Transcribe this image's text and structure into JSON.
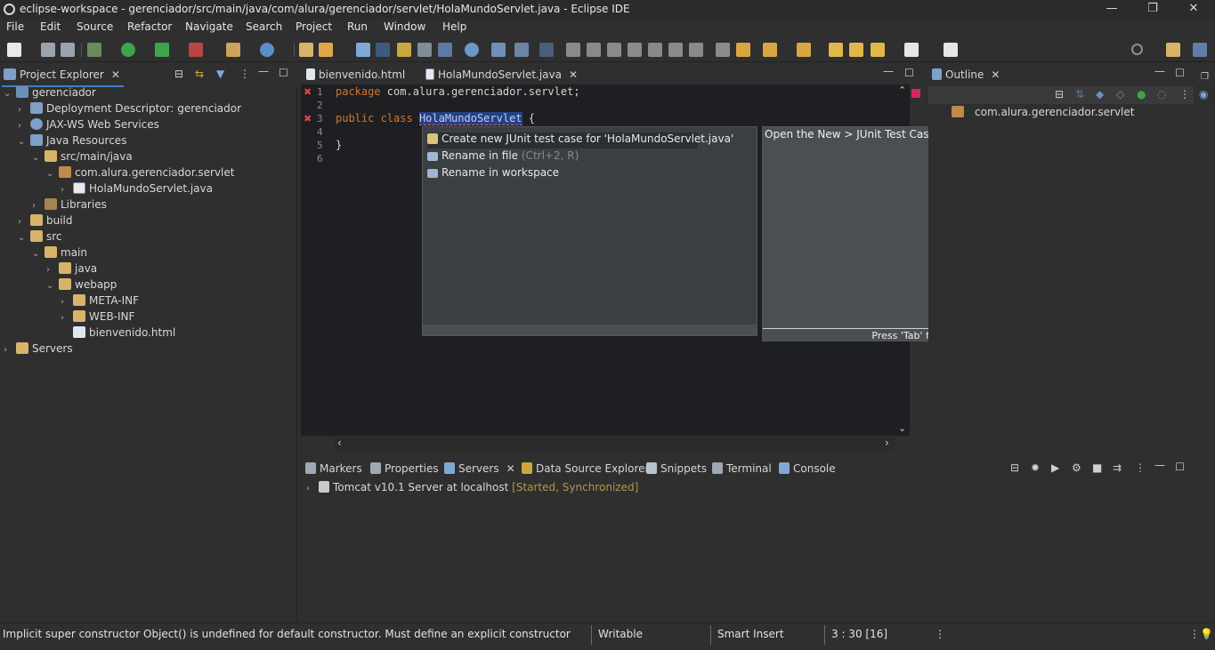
{
  "window": {
    "title": "eclipse-workspace - gerenciador/src/main/java/com/alura/gerenciador/servlet/HolaMundoServlet.java - Eclipse IDE",
    "minimize": "—",
    "maximize": "❐",
    "close": "✕"
  },
  "menu": [
    "File",
    "Edit",
    "Source",
    "Refactor",
    "Navigate",
    "Search",
    "Project",
    "Run",
    "Window",
    "Help"
  ],
  "project_explorer": {
    "tab_label": "Project Explorer",
    "items": [
      {
        "label": "gerenciador",
        "twisty": "⌄",
        "icon": "project-icon"
      },
      {
        "label": "Deployment Descriptor: gerenciador",
        "twisty": "›",
        "icon": "deployment-descriptor-icon"
      },
      {
        "label": "JAX-WS Web Services",
        "twisty": "›",
        "icon": "web-services-icon"
      },
      {
        "label": "Java Resources",
        "twisty": "⌄",
        "icon": "java-resources-icon"
      },
      {
        "label": "src/main/java",
        "twisty": "⌄",
        "icon": "source-folder-icon"
      },
      {
        "label": "com.alura.gerenciador.servlet",
        "twisty": "⌄",
        "icon": "package-icon"
      },
      {
        "label": "HolaMundoServlet.java",
        "twisty": "›",
        "icon": "java-file-icon"
      },
      {
        "label": "Libraries",
        "twisty": "›",
        "icon": "libraries-icon"
      },
      {
        "label": "build",
        "twisty": "›",
        "icon": "folder-icon"
      },
      {
        "label": "src",
        "twisty": "⌄",
        "icon": "folder-icon"
      },
      {
        "label": "main",
        "twisty": "⌄",
        "icon": "folder-icon"
      },
      {
        "label": "java",
        "twisty": "›",
        "icon": "folder-icon"
      },
      {
        "label": "webapp",
        "twisty": "⌄",
        "icon": "folder-icon"
      },
      {
        "label": "META-INF",
        "twisty": "›",
        "icon": "folder-icon"
      },
      {
        "label": "WEB-INF",
        "twisty": "›",
        "icon": "folder-icon"
      },
      {
        "label": "bienvenido.html",
        "twisty": "",
        "icon": "html-file-icon"
      },
      {
        "label": "Servers",
        "twisty": "›",
        "icon": "servers-folder-icon"
      }
    ]
  },
  "editor": {
    "tabs": [
      {
        "label": "bienvenido.html"
      },
      {
        "label": "HolaMundoServlet.java"
      }
    ],
    "line_numbers": [
      "1",
      "2",
      "3",
      "4",
      "5",
      "6"
    ],
    "line1_kw": "package",
    "line1_rest": " com.alura.gerenciador.servlet;",
    "line3_kw": "public class",
    "line3_class": "HolaMundoServlet",
    "line3_brace": " {",
    "line5": "}"
  },
  "quick_fix": {
    "proposals": [
      {
        "label": "Create new JUnit test case for 'HolaMundoServlet.java'",
        "hint": ""
      },
      {
        "label": "Rename in file",
        "hint": " (Ctrl+2, R)"
      },
      {
        "label": "Rename in workspace",
        "hint": ""
      }
    ],
    "info_text": "Open the New > JUnit Test Case wizard.",
    "footer": "Press 'Tab' from proposal table or click for focus"
  },
  "outline": {
    "tab_label": "Outline",
    "items": [
      "com.alura.gerenciador.servlet"
    ]
  },
  "bottom_panel": {
    "tabs": [
      "Markers",
      "Properties",
      "Servers",
      "Data Source Explorer",
      "Snippets",
      "Terminal",
      "Console"
    ],
    "server_name": "Tomcat v10.1 Server at localhost",
    "server_state": "[Started, Synchronized]"
  },
  "status_bar": {
    "message": "Implicit super constructor Object() is undefined for default constructor. Must define an explicit constructor",
    "writable": "Writable",
    "insert_mode": "Smart Insert",
    "position": "3 : 30 [16]"
  }
}
